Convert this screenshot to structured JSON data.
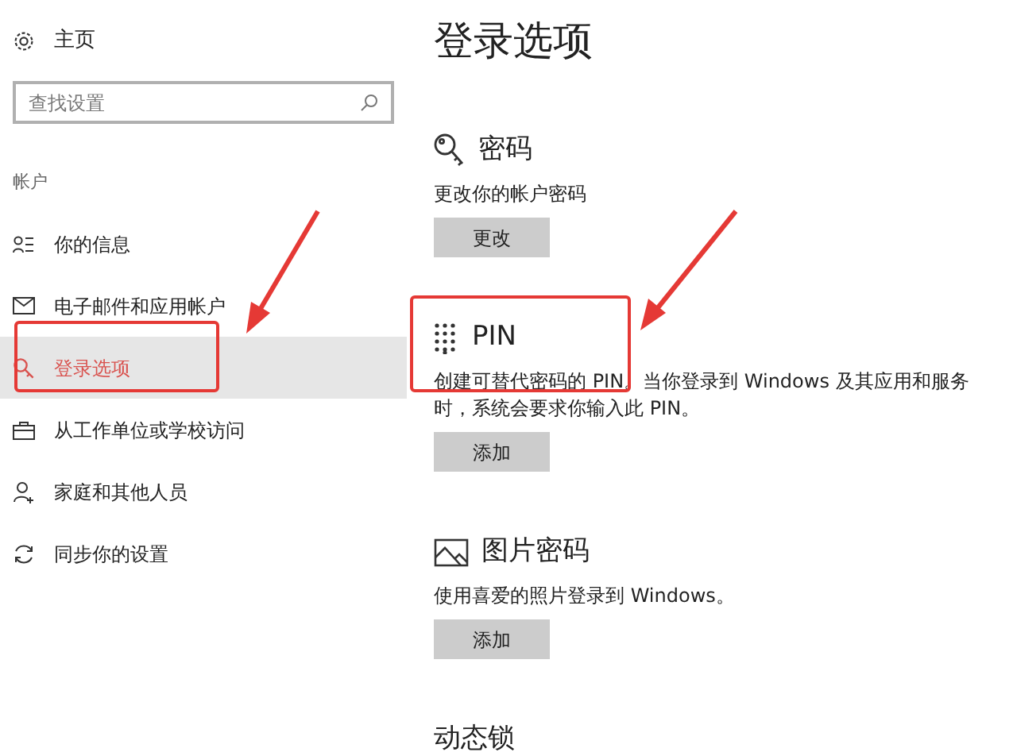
{
  "sidebar": {
    "home": "主页",
    "search": {
      "placeholder": "查找设置"
    },
    "group": "帐户",
    "items": [
      {
        "label": "你的信息",
        "selected": false
      },
      {
        "label": "电子邮件和应用帐户",
        "selected": false
      },
      {
        "label": "登录选项",
        "selected": true
      },
      {
        "label": "从工作单位或学校访问",
        "selected": false
      },
      {
        "label": "家庭和其他人员",
        "selected": false
      },
      {
        "label": "同步你的设置",
        "selected": false
      }
    ]
  },
  "page": {
    "title": "登录选项",
    "sections": [
      {
        "heading": "密码",
        "description": "更改你的帐户密码",
        "button": "更改"
      },
      {
        "heading": "PIN",
        "description": "创建可替代密码的 PIN。当你登录到 Windows 及其应用和服务时，系统会要求你输入此 PIN。",
        "button": "添加"
      },
      {
        "heading": "图片密码",
        "description": "使用喜爱的照片登录到 Windows。",
        "button": "添加"
      },
      {
        "heading": "动态锁"
      }
    ]
  }
}
